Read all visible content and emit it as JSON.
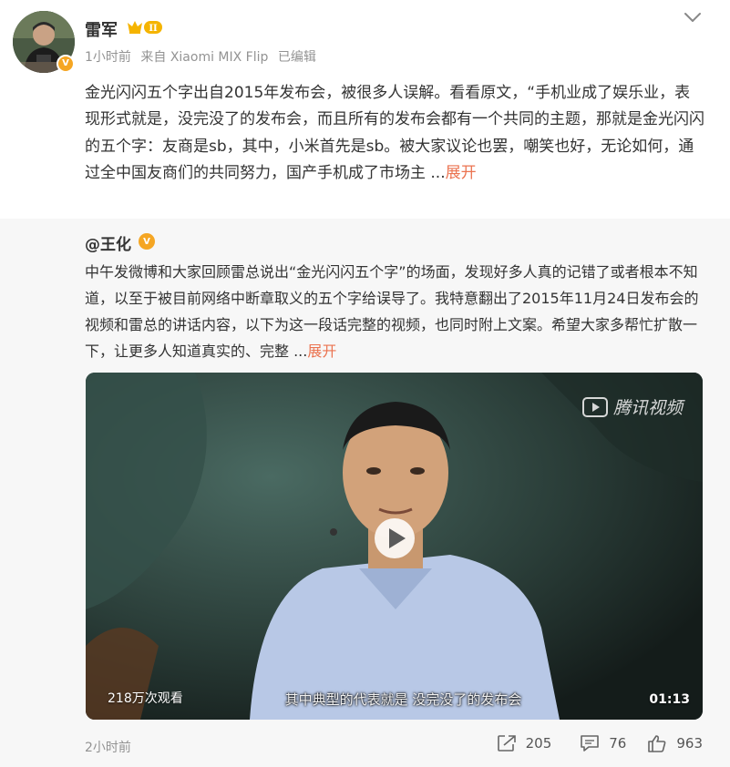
{
  "post": {
    "author": "雷军",
    "meta": {
      "time": "1小时前",
      "source": "来自 Xiaomi MIX Flip",
      "edited": "已编辑"
    },
    "text": "金光闪闪五个字出自2015年发布会，被很多人误解。看看原文，“手机业成了娱乐业，表现形式就是，没完没了的发布会，而且所有的发布会都有一个共同的主题，那就是金光闪闪的五个字：友商是sb，其中，小米首先是sb。被大家议论也罢，嘲笑也好，无论如何，通过全中国友商们的共同努力，国产手机成了市场主 ...",
    "expand_label": "展开",
    "member_level": "II",
    "verified_mark": "V"
  },
  "repost": {
    "author": "@王化",
    "verified_mark": "V",
    "text": "中午发微博和大家回顾雷总说出“金光闪闪五个字”的场面，发现好多人真的记错了或者根本不知道，以至于被目前网络中断章取义的五个字给误导了。我特意翻出了2015年11月24日发布会的视频和雷总的讲话内容，以下为这一段话完整的视频，也同时附上文案。希望大家多帮忙扩散一下，让更多人知道真实的、完整 ...",
    "expand_label": "展开",
    "video": {
      "watermark": "腾讯视频",
      "views": "218万次观看",
      "duration": "01:13",
      "subtitle": "其中典型的代表就是 没完没了的发布会"
    },
    "time": "2小时前",
    "shares": "205",
    "comments": "76",
    "likes": "963"
  },
  "colors": {
    "accent": "#eb7350",
    "meta_gray": "#939393",
    "repost_bg": "#f7f7f7",
    "verified_orange": "#f5a623"
  }
}
